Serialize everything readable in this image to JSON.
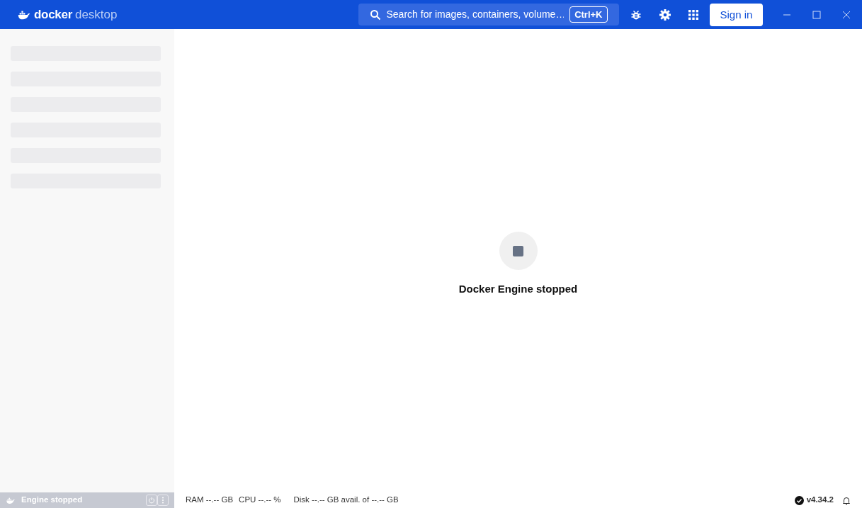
{
  "window": {
    "logo": {
      "brand": "docker",
      "product": "desktop"
    }
  },
  "header": {
    "search": {
      "placeholder": "Search for images, containers, volume…",
      "shortcut": "Ctrl+K"
    },
    "sign_in": "Sign in"
  },
  "sidebar": {
    "loading": true
  },
  "main": {
    "message": "Docker Engine stopped"
  },
  "status_bar": {
    "engine": "Engine stopped",
    "ram": "RAM --.-- GB",
    "cpu": "CPU --.-- %",
    "disk": "Disk --.-- GB avail. of --.-- GB",
    "version": "v4.34.2"
  }
}
